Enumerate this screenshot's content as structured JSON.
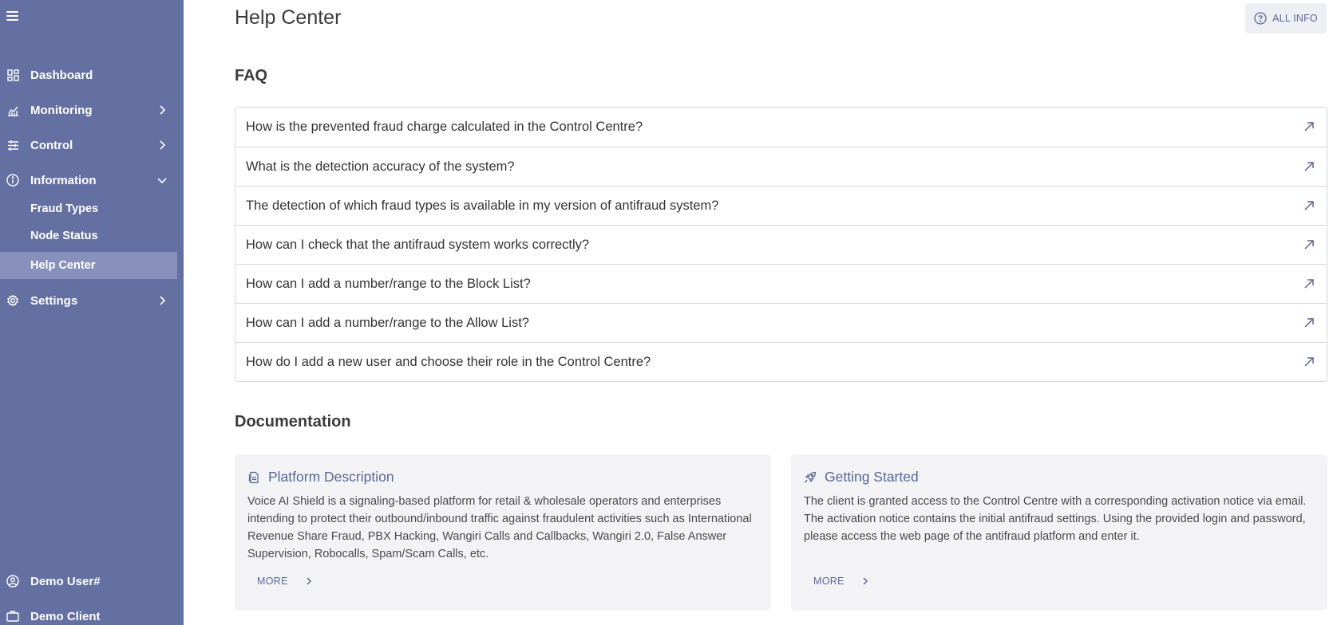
{
  "sidebar": {
    "items": [
      {
        "label": "Dashboard"
      },
      {
        "label": "Monitoring"
      },
      {
        "label": "Control"
      },
      {
        "label": "Information"
      },
      {
        "label": "Settings"
      }
    ],
    "sub_items": [
      {
        "label": "Fraud Types"
      },
      {
        "label": "Node Status"
      },
      {
        "label": "Help Center"
      }
    ],
    "user": "Demo User#",
    "client": "Demo Client",
    "icons": [
      "menu-icon",
      "dashboard-icon",
      "monitoring-icon",
      "control-icon",
      "info-icon",
      "settings-icon",
      "user-icon",
      "briefcase-icon"
    ]
  },
  "header": {
    "title": "Help Center",
    "all_info_label": "ALL INFO"
  },
  "faq": {
    "title": "FAQ",
    "questions": [
      "How is the prevented fraud charge calculated in the Control Centre?",
      "What is the detection accuracy of the system?",
      "The detection of which fraud types is available in my version of antifraud system?",
      "How can I check that the antifraud system works correctly?",
      "How can I add a number/range to the Block List?",
      "How can I add a number/range to the Allow List?",
      "How do I add a new user and choose their role in the Control Centre?"
    ]
  },
  "documentation": {
    "title": "Documentation",
    "cards": [
      {
        "title": "Platform Description",
        "body": "Voice AI Shield is a signaling-based platform for retail & wholesale operators and enterprises intending to protect their outbound/inbound traffic against fraudulent activities such as International Revenue Share Fraud, PBX Hacking, Wangiri Calls and Callbacks, Wangiri 2.0, False Answer Supervision, Robocalls, Spam/Scam Calls, etc.",
        "more": "MORE"
      },
      {
        "title": "Getting Started",
        "body": "The client is granted access to the Control Centre with a corresponding activation notice via email. The activation notice contains the initial antifraud settings. Using the provided login and password, please access the web page of the antifraud platform and enter it.",
        "more": "MORE"
      }
    ]
  },
  "colors": {
    "sidebar_bg": "#6370a1",
    "sidebar_active": "#8891bb",
    "accent": "#5a6796"
  }
}
